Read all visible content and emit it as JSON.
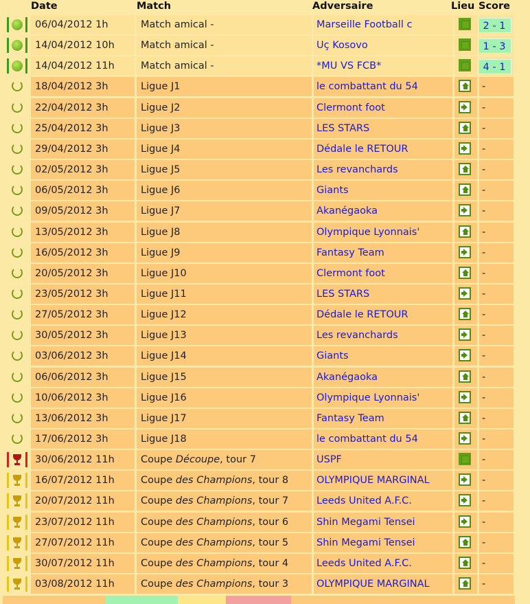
{
  "header": {
    "date": "Date",
    "match": "Match",
    "opponent": "Adversaire",
    "lieu": "Lieu",
    "score": "Score"
  },
  "rows": [
    {
      "type": "friendly",
      "date": "06/04/2012 1h",
      "m1": "Match amical -",
      "m2": "",
      "m3": "",
      "opp": "Marseille Football c",
      "lieu": "played",
      "score": "2 - 1",
      "win": true
    },
    {
      "type": "friendly",
      "date": "14/04/2012 10h",
      "m1": "Match amical -",
      "m2": "",
      "m3": "",
      "opp": "Uç Kosovo",
      "lieu": "played",
      "score": "1 - 3",
      "win": true
    },
    {
      "type": "friendly",
      "date": "14/04/2012 11h",
      "m1": "Match amical -",
      "m2": "",
      "m3": "",
      "opp": "*MU VS FCB*",
      "lieu": "played",
      "score": "4 - 1",
      "win": true
    },
    {
      "type": "league",
      "date": "18/04/2012 3h",
      "m1": "Ligue J1",
      "m2": "",
      "m3": "",
      "opp": "le combattant du 54",
      "lieu": "home",
      "score": "-"
    },
    {
      "type": "league",
      "date": "22/04/2012 3h",
      "m1": "Ligue J2",
      "m2": "",
      "m3": "",
      "opp": "Clermont foot",
      "lieu": "away",
      "score": "-"
    },
    {
      "type": "league",
      "date": "25/04/2012 3h",
      "m1": "Ligue J3",
      "m2": "",
      "m3": "",
      "opp": "LES STARS",
      "lieu": "home",
      "score": "-"
    },
    {
      "type": "league",
      "date": "29/04/2012 3h",
      "m1": "Ligue J4",
      "m2": "",
      "m3": "",
      "opp": "Dédale le RETOUR",
      "lieu": "away",
      "score": "-"
    },
    {
      "type": "league",
      "date": "02/05/2012 3h",
      "m1": "Ligue J5",
      "m2": "",
      "m3": "",
      "opp": "Les revanchards",
      "lieu": "home",
      "score": "-"
    },
    {
      "type": "league",
      "date": "06/05/2012 3h",
      "m1": "Ligue J6",
      "m2": "",
      "m3": "",
      "opp": "Giants",
      "lieu": "home",
      "score": "-"
    },
    {
      "type": "league",
      "date": "09/05/2012 3h",
      "m1": "Ligue J7",
      "m2": "",
      "m3": "",
      "opp": "Akanégaoka",
      "lieu": "away",
      "score": "-"
    },
    {
      "type": "league",
      "date": "13/05/2012 3h",
      "m1": "Ligue J8",
      "m2": "",
      "m3": "",
      "opp": "Olympique Lyonnais'",
      "lieu": "home",
      "score": "-"
    },
    {
      "type": "league",
      "date": "16/05/2012 3h",
      "m1": "Ligue J9",
      "m2": "",
      "m3": "",
      "opp": "Fantasy Team",
      "lieu": "away",
      "score": "-"
    },
    {
      "type": "league",
      "date": "20/05/2012 3h",
      "m1": "Ligue J10",
      "m2": "",
      "m3": "",
      "opp": "Clermont foot",
      "lieu": "home",
      "score": "-"
    },
    {
      "type": "league",
      "date": "23/05/2012 3h",
      "m1": "Ligue J11",
      "m2": "",
      "m3": "",
      "opp": "LES STARS",
      "lieu": "away",
      "score": "-"
    },
    {
      "type": "league",
      "date": "27/05/2012 3h",
      "m1": "Ligue J12",
      "m2": "",
      "m3": "",
      "opp": "Dédale le RETOUR",
      "lieu": "home",
      "score": "-"
    },
    {
      "type": "league",
      "date": "30/05/2012 3h",
      "m1": "Ligue J13",
      "m2": "",
      "m3": "",
      "opp": "Les revanchards",
      "lieu": "away",
      "score": "-"
    },
    {
      "type": "league",
      "date": "03/06/2012 3h",
      "m1": "Ligue J14",
      "m2": "",
      "m3": "",
      "opp": "Giants",
      "lieu": "away",
      "score": "-"
    },
    {
      "type": "league",
      "date": "06/06/2012 3h",
      "m1": "Ligue J15",
      "m2": "",
      "m3": "",
      "opp": "Akanégaoka",
      "lieu": "home",
      "score": "-"
    },
    {
      "type": "league",
      "date": "10/06/2012 3h",
      "m1": "Ligue J16",
      "m2": "",
      "m3": "",
      "opp": "Olympique Lyonnais'",
      "lieu": "away",
      "score": "-"
    },
    {
      "type": "league",
      "date": "13/06/2012 3h",
      "m1": "Ligue J17",
      "m2": "",
      "m3": "",
      "opp": "Fantasy Team",
      "lieu": "home",
      "score": "-"
    },
    {
      "type": "league",
      "date": "17/06/2012 3h",
      "m1": "Ligue J18",
      "m2": "",
      "m3": "",
      "opp": "le combattant du 54",
      "lieu": "away",
      "score": "-"
    },
    {
      "type": "cupr",
      "date": "30/06/2012 11h",
      "m1": "Coupe ",
      "m2": "Découpe",
      "m3": ", tour 7",
      "opp": "USPF",
      "lieu": "played",
      "score": "-"
    },
    {
      "type": "cupy",
      "date": "16/07/2012 11h",
      "m1": "Coupe ",
      "m2": "des Champions",
      "m3": ", tour 8",
      "opp": "OLYMPIQUE MARGINAL",
      "lieu": "away",
      "score": "-"
    },
    {
      "type": "cupy",
      "date": "20/07/2012 11h",
      "m1": "Coupe ",
      "m2": "des Champions",
      "m3": ", tour 7",
      "opp": "Leeds United A.F.C.",
      "lieu": "away",
      "score": "-"
    },
    {
      "type": "cupy",
      "date": "23/07/2012 11h",
      "m1": "Coupe ",
      "m2": "des Champions",
      "m3": ", tour 6",
      "opp": "Shin Megami Tensei",
      "lieu": "away",
      "score": "-"
    },
    {
      "type": "cupy",
      "date": "27/07/2012 11h",
      "m1": "Coupe ",
      "m2": "des Champions",
      "m3": ", tour 5",
      "opp": "Shin Megami Tensei",
      "lieu": "home",
      "score": "-"
    },
    {
      "type": "cupy",
      "date": "30/07/2012 11h",
      "m1": "Coupe ",
      "m2": "des Champions",
      "m3": ", tour 4",
      "opp": "Leeds United A.F.C.",
      "lieu": "home",
      "score": "-"
    },
    {
      "type": "cupy",
      "date": "03/08/2012 11h",
      "m1": "Coupe ",
      "m2": "des Champions",
      "m3": ", tour 3",
      "opp": "OLYMPIQUE MARGINAL",
      "lieu": "home",
      "score": "-"
    }
  ]
}
